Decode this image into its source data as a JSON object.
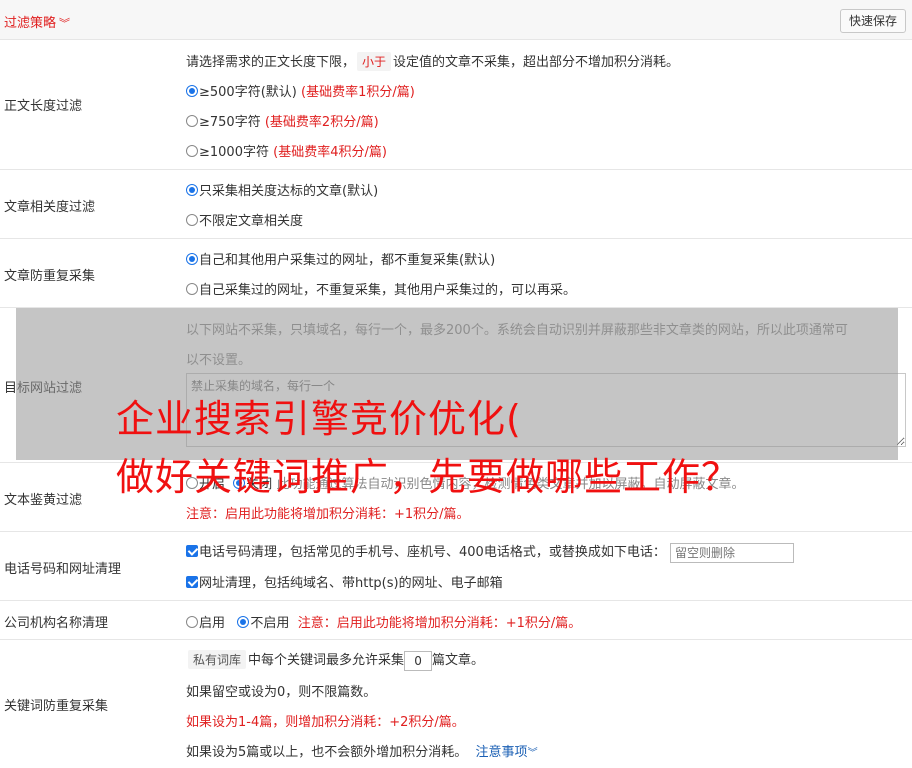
{
  "header": {
    "title": "过滤策略",
    "save_label": "快速保存"
  },
  "length_filter": {
    "label": "正文长度过滤",
    "desc_pre": "请选择需求的正文长度下限，",
    "desc_pill": "小于",
    "desc_post": "设定值的文章不采集，超出部分不增加积分消耗。",
    "options": [
      {
        "text": "≥500字符(默认)",
        "note": "(基础费率1积分/篇)"
      },
      {
        "text": "≥750字符",
        "note": "(基础费率2积分/篇)"
      },
      {
        "text": "≥1000字符",
        "note": "(基础费率4积分/篇)"
      }
    ]
  },
  "relevance": {
    "label": "文章相关度过滤",
    "options": [
      "只采集相关度达标的文章(默认)",
      "不限定文章相关度"
    ]
  },
  "dedup": {
    "label": "文章防重复采集",
    "options": [
      "自己和其他用户采集过的网址，都不重复采集(默认)",
      "自己采集过的网址，不重复采集，其他用户采集过的，可以再采。"
    ]
  },
  "target_site": {
    "label": "目标网站过滤",
    "desc_line1": "以下网站不采集，只填域名，每行一个，最多200个。系统会自动识别并屏蔽那些非文章类的网站，所以此项通常可",
    "desc_line2": "以不设置。",
    "placeholder": "禁止采集的域名，每行一个"
  },
  "porn_filter": {
    "label": "文本鉴黄过滤",
    "opt_on": "开启",
    "opt_off": "关闭",
    "desc": "此功能通过算法自动识别色情内容，检测情色类文章并加以屏蔽。自动屏蔽文章。",
    "note": "注意：启用此功能将增加积分消耗：+1积分/篇。"
  },
  "phone_clean": {
    "label": "电话号码和网址清理",
    "phone_text": "电话号码清理，包括常见的手机号、座机号、400电话格式，或替换成如下电话：",
    "phone_placeholder": "留空则删除",
    "url_text": "网址清理，包括纯域名、带http(s)的网址、电子邮箱"
  },
  "org_clean": {
    "label": "公司机构名称清理",
    "opt_on": "启用",
    "opt_off": "不启用",
    "note": "注意：启用此功能将增加积分消耗：+1积分/篇。"
  },
  "keyword_dedup": {
    "label": "关键词防重复采集",
    "pill": "私有词库",
    "text_pre": "中每个关键词最多允许采集",
    "value": "0",
    "text_post": "篇文章。",
    "line2": "如果留空或设为0，则不限篇数。",
    "line3": "如果设为1-4篇，则增加积分消耗：+2积分/篇。",
    "line4": "如果设为5篇或以上，也不会额外增加积分消耗。",
    "notes_link": "注意事项"
  },
  "overlay": {
    "line1": "企业搜索引擎竞价优化(",
    "line2": "做好关键词推广，先要做哪些工作？"
  },
  "colors": {
    "accent_red": "#e02020",
    "accent_blue": "#1a73e8",
    "overlay_red": "#f01010"
  }
}
